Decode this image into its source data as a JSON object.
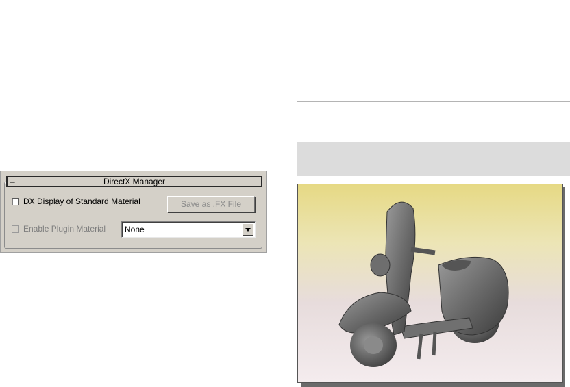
{
  "directx_manager": {
    "collapse_symbol": "–",
    "title": "DirectX Manager",
    "dx_display_checkbox": {
      "label": "DX Display of Standard Material",
      "checked": false
    },
    "save_button": {
      "label": "Save as .FX File",
      "enabled": false
    },
    "plugin_checkbox": {
      "label": "Enable Plugin Material",
      "checked": false,
      "enabled": false
    },
    "plugin_dropdown": {
      "selected": "None"
    }
  },
  "viewport": {
    "content": "scooter-render",
    "background_top": "#e6d984",
    "background_bottom": "#f4ecee"
  },
  "colors": {
    "panel": "#d4d0c8",
    "disabled_text": "#7e7e7e"
  }
}
